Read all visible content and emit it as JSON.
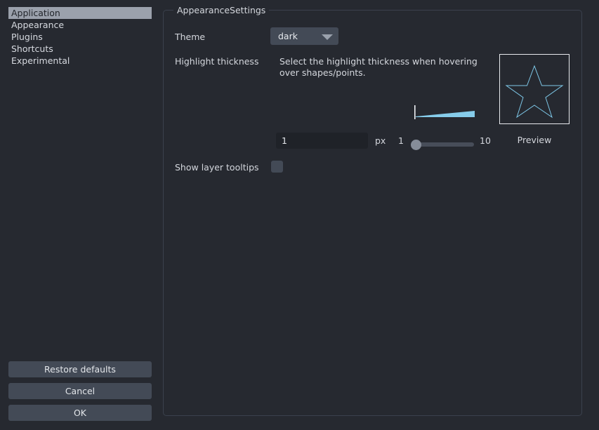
{
  "sidebar": {
    "items": [
      {
        "label": "Application",
        "selected": true
      },
      {
        "label": "Appearance",
        "selected": false
      },
      {
        "label": "Plugins",
        "selected": false
      },
      {
        "label": "Shortcuts",
        "selected": false
      },
      {
        "label": "Experimental",
        "selected": false
      }
    ],
    "buttons": {
      "restore_defaults": "Restore defaults",
      "cancel": "Cancel",
      "ok": "OK"
    }
  },
  "panel": {
    "group_title": "AppearanceSettings",
    "theme": {
      "label": "Theme",
      "value": "dark",
      "arrow_icon": "chevron-down-icon"
    },
    "highlight_thickness": {
      "label": "Highlight thickness",
      "description": "Select the highlight thickness when hovering over shapes/points.",
      "value": "1",
      "unit": "px",
      "slider_min": "1",
      "slider_max": "10",
      "slider_value": 1,
      "wedge_color": "#86ccea"
    },
    "preview": {
      "caption": "Preview",
      "shape_icon": "star-icon",
      "shape_color": "#7ec8e8",
      "border_color": "#e8eaee"
    },
    "show_layer_tooltips": {
      "label": "Show layer tooltips",
      "checked": false
    }
  },
  "colors": {
    "background": "#262930",
    "selection": "#9ba1ac",
    "button": "#434a56",
    "input": "#1f2228",
    "accent": "#86ccea",
    "border": "#3b414d"
  }
}
